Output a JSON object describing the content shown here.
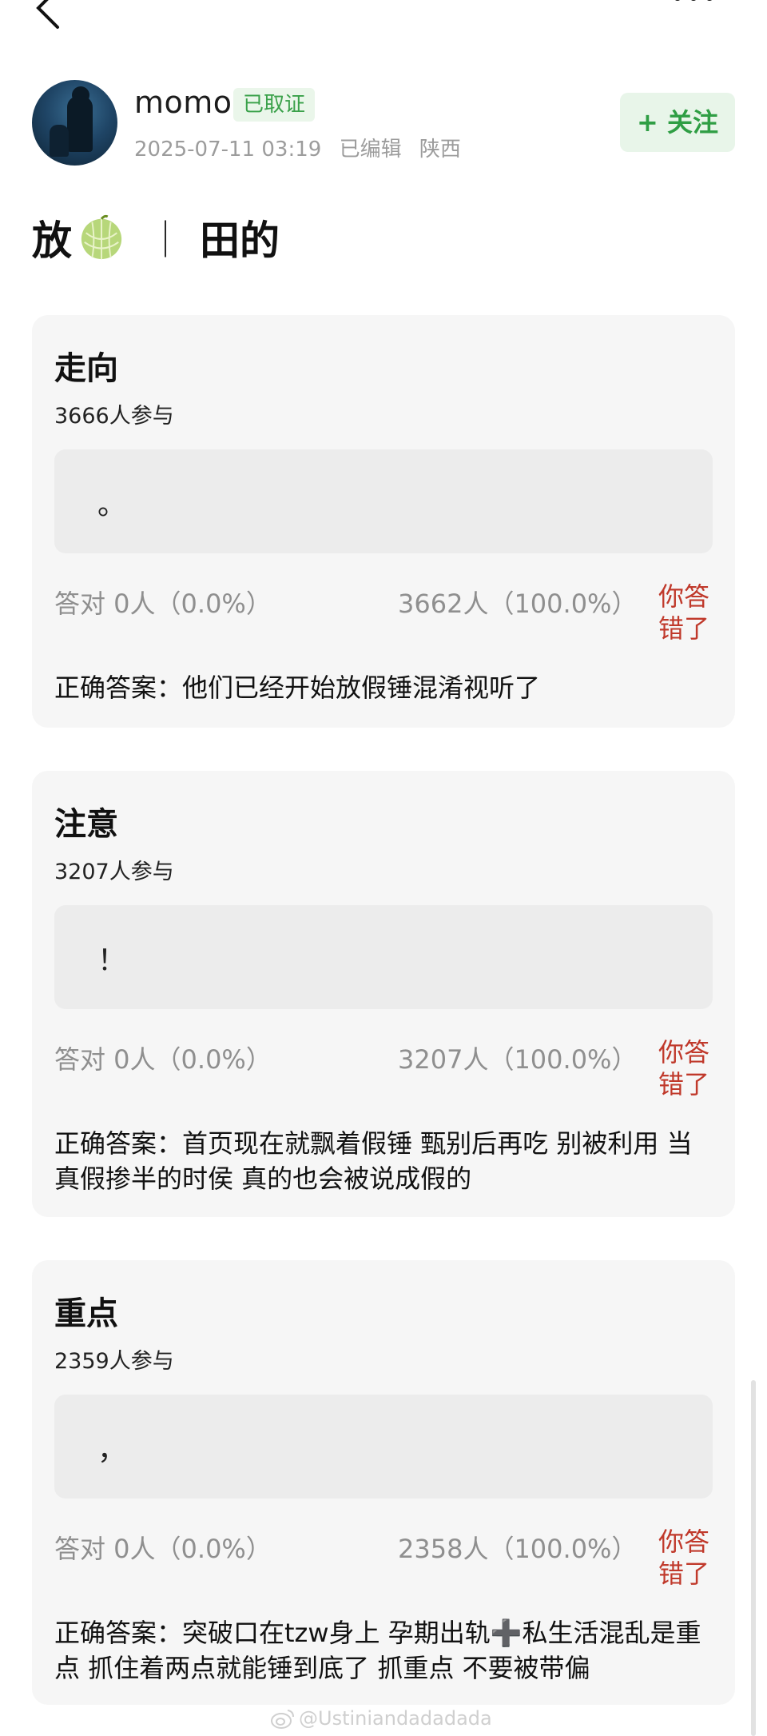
{
  "author": {
    "name": "momo",
    "badge": "已取证",
    "time": "2025-07-11 03:19",
    "edited": "已编辑",
    "location": "陕西",
    "follow_label": "+ 关注"
  },
  "post": {
    "title_left": "放",
    "separator": "｜",
    "title_right": "田的"
  },
  "quizzes": [
    {
      "title": "走向",
      "participants": "3666人参与",
      "option_text": "。",
      "correct_stat": "答对  0人（0.0%）",
      "wrong_stat": "3662人（100.0%）",
      "verdict": "你答错了",
      "answer": "正确答案：他们已经开始放假锤混淆视听了"
    },
    {
      "title": "注意",
      "participants": "3207人参与",
      "option_text": "！",
      "correct_stat": "答对  0人（0.0%）",
      "wrong_stat": "3207人（100.0%）",
      "verdict": "你答错了",
      "answer": "正确答案：首页现在就飘着假锤 甄别后再吃 别被利用 当真假掺半的时侯 真的也会被说成假的"
    },
    {
      "title": "重点",
      "participants": "2359人参与",
      "option_text": "，",
      "correct_stat": "答对  0人（0.0%）",
      "wrong_stat": "2358人（100.0%）",
      "verdict": "你答错了",
      "answer": "正确答案：突破口在tzw身上 孕期出轨➕私生活混乱是重点 抓住着两点就能锤到底了 抓重点 不要被带偏"
    }
  ],
  "watermark": "@Ustiniandadadada",
  "colors": {
    "accent_green": "#2f9e44",
    "verdict_red": "#c0392b",
    "card_bg": "#f6f6f6"
  },
  "icons": [
    "back-arrow-icon",
    "more-icon",
    "melon-icon",
    "weibo-icon"
  ]
}
